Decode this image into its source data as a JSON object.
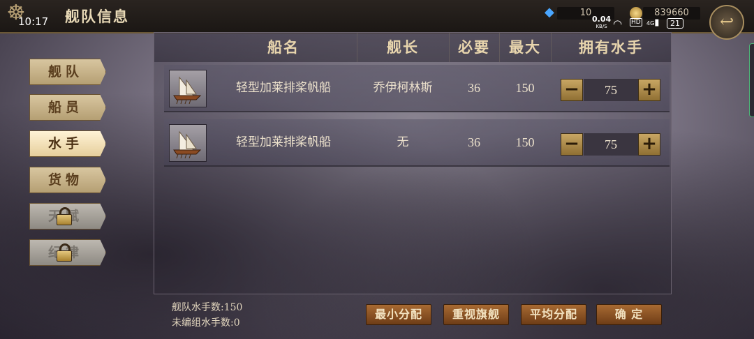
{
  "status_bar": {
    "time": "10:17",
    "net_speed": "0.04",
    "net_unit": "KB/S",
    "hd": "HD",
    "signal": "4G",
    "battery": "21"
  },
  "header": {
    "title": "舰队信息",
    "gems": "10",
    "coins": "839660"
  },
  "sidebar": {
    "items": [
      {
        "label": "舰队",
        "state": "normal"
      },
      {
        "label": "船员",
        "state": "normal"
      },
      {
        "label": "水手",
        "state": "active"
      },
      {
        "label": "货物",
        "state": "normal"
      },
      {
        "label": "天赋",
        "state": "locked"
      },
      {
        "label": "纪律",
        "state": "locked"
      }
    ]
  },
  "table": {
    "headers": [
      "船名",
      "舰长",
      "必要",
      "最大",
      "拥有水手"
    ],
    "rows": [
      {
        "ship_name": "轻型加莱排桨帆船",
        "captain": "乔伊柯林斯",
        "required": "36",
        "max": "150",
        "sailors": "75"
      },
      {
        "ship_name": "轻型加莱排桨帆船",
        "captain": "无",
        "required": "36",
        "max": "150",
        "sailors": "75"
      }
    ],
    "minus_label": "−",
    "plus_label": "+"
  },
  "footer": {
    "fleet_sailors_label": "舰队水手数:",
    "fleet_sailors_value": "150",
    "unassigned_label": "未编组水手数:",
    "unassigned_value": "0",
    "buttons": {
      "min_alloc": "最小分配",
      "focus_flagship": "重视旗舰",
      "even_alloc": "平均分配",
      "confirm": "确 定"
    }
  },
  "colors": {
    "accent_gold": "#c9a764",
    "button_brown": "#8a5226",
    "active_tab": "#fff3d6"
  }
}
